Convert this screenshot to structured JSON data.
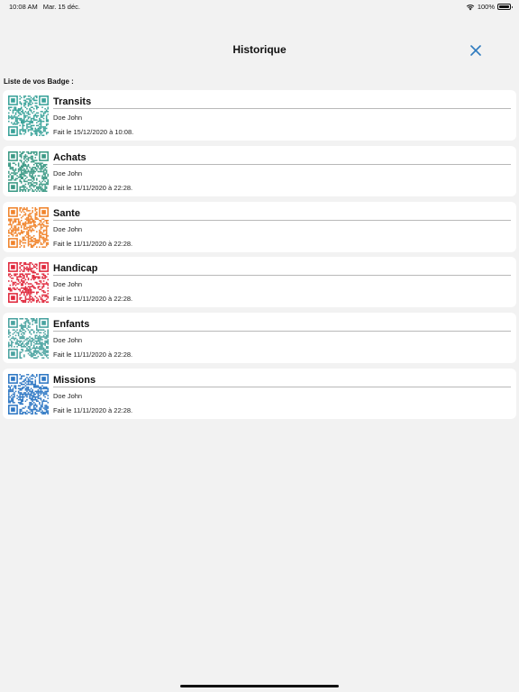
{
  "status_bar": {
    "time": "10:08 AM",
    "date": "Mar. 15 déc.",
    "battery": "100%"
  },
  "nav": {
    "title": "Historique",
    "close_icon": "close-icon"
  },
  "section_label": "Liste de vos Badge :",
  "badges": [
    {
      "title": "Transits",
      "owner": "Doe John",
      "date": "Fait le 15/12/2020 à 10:08.",
      "color": "#3aa39a"
    },
    {
      "title": "Achats",
      "owner": "Doe John",
      "date": "Fait le 11/11/2020 à 22:28.",
      "color": "#3c9a86"
    },
    {
      "title": "Sante",
      "owner": "Doe John",
      "date": "Fait le 11/11/2020 à 22:28.",
      "color": "#f0842c"
    },
    {
      "title": "Handicap",
      "owner": "Doe John",
      "date": "Fait le 11/11/2020 à 22:28.",
      "color": "#e0283c"
    },
    {
      "title": "Enfants",
      "owner": "Doe John",
      "date": "Fait le 11/11/2020 à 22:28.",
      "color": "#4aa3a0"
    },
    {
      "title": "Missions",
      "owner": "Doe John",
      "date": "Fait le 11/11/2020 à 22:28.",
      "color": "#2f78c4"
    }
  ],
  "colors": {
    "accent": "#2f7bbf",
    "background": "#f2f2f2",
    "card": "#ffffff"
  }
}
